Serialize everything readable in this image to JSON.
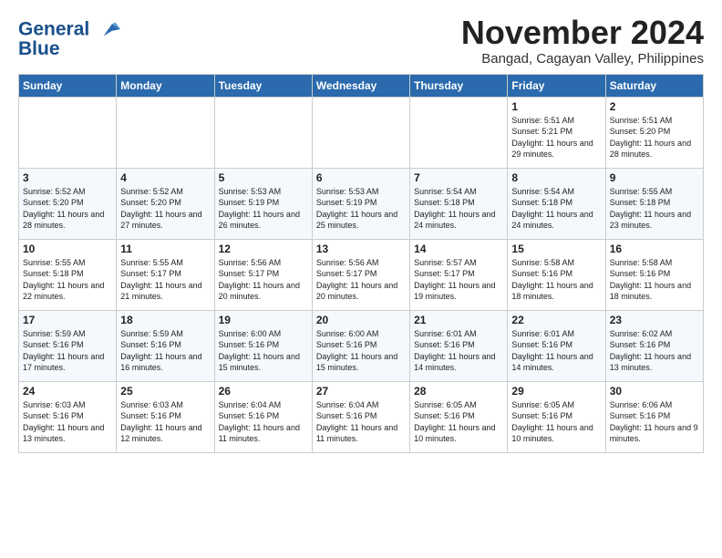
{
  "logo": {
    "line1": "General",
    "line2": "Blue"
  },
  "title": "November 2024",
  "subtitle": "Bangad, Cagayan Valley, Philippines",
  "days_of_week": [
    "Sunday",
    "Monday",
    "Tuesday",
    "Wednesday",
    "Thursday",
    "Friday",
    "Saturday"
  ],
  "weeks": [
    [
      {
        "day": "",
        "info": ""
      },
      {
        "day": "",
        "info": ""
      },
      {
        "day": "",
        "info": ""
      },
      {
        "day": "",
        "info": ""
      },
      {
        "day": "",
        "info": ""
      },
      {
        "day": "1",
        "info": "Sunrise: 5:51 AM\nSunset: 5:21 PM\nDaylight: 11 hours and 29 minutes."
      },
      {
        "day": "2",
        "info": "Sunrise: 5:51 AM\nSunset: 5:20 PM\nDaylight: 11 hours and 28 minutes."
      }
    ],
    [
      {
        "day": "3",
        "info": "Sunrise: 5:52 AM\nSunset: 5:20 PM\nDaylight: 11 hours and 28 minutes."
      },
      {
        "day": "4",
        "info": "Sunrise: 5:52 AM\nSunset: 5:20 PM\nDaylight: 11 hours and 27 minutes."
      },
      {
        "day": "5",
        "info": "Sunrise: 5:53 AM\nSunset: 5:19 PM\nDaylight: 11 hours and 26 minutes."
      },
      {
        "day": "6",
        "info": "Sunrise: 5:53 AM\nSunset: 5:19 PM\nDaylight: 11 hours and 25 minutes."
      },
      {
        "day": "7",
        "info": "Sunrise: 5:54 AM\nSunset: 5:18 PM\nDaylight: 11 hours and 24 minutes."
      },
      {
        "day": "8",
        "info": "Sunrise: 5:54 AM\nSunset: 5:18 PM\nDaylight: 11 hours and 24 minutes."
      },
      {
        "day": "9",
        "info": "Sunrise: 5:55 AM\nSunset: 5:18 PM\nDaylight: 11 hours and 23 minutes."
      }
    ],
    [
      {
        "day": "10",
        "info": "Sunrise: 5:55 AM\nSunset: 5:18 PM\nDaylight: 11 hours and 22 minutes."
      },
      {
        "day": "11",
        "info": "Sunrise: 5:55 AM\nSunset: 5:17 PM\nDaylight: 11 hours and 21 minutes."
      },
      {
        "day": "12",
        "info": "Sunrise: 5:56 AM\nSunset: 5:17 PM\nDaylight: 11 hours and 20 minutes."
      },
      {
        "day": "13",
        "info": "Sunrise: 5:56 AM\nSunset: 5:17 PM\nDaylight: 11 hours and 20 minutes."
      },
      {
        "day": "14",
        "info": "Sunrise: 5:57 AM\nSunset: 5:17 PM\nDaylight: 11 hours and 19 minutes."
      },
      {
        "day": "15",
        "info": "Sunrise: 5:58 AM\nSunset: 5:16 PM\nDaylight: 11 hours and 18 minutes."
      },
      {
        "day": "16",
        "info": "Sunrise: 5:58 AM\nSunset: 5:16 PM\nDaylight: 11 hours and 18 minutes."
      }
    ],
    [
      {
        "day": "17",
        "info": "Sunrise: 5:59 AM\nSunset: 5:16 PM\nDaylight: 11 hours and 17 minutes."
      },
      {
        "day": "18",
        "info": "Sunrise: 5:59 AM\nSunset: 5:16 PM\nDaylight: 11 hours and 16 minutes."
      },
      {
        "day": "19",
        "info": "Sunrise: 6:00 AM\nSunset: 5:16 PM\nDaylight: 11 hours and 15 minutes."
      },
      {
        "day": "20",
        "info": "Sunrise: 6:00 AM\nSunset: 5:16 PM\nDaylight: 11 hours and 15 minutes."
      },
      {
        "day": "21",
        "info": "Sunrise: 6:01 AM\nSunset: 5:16 PM\nDaylight: 11 hours and 14 minutes."
      },
      {
        "day": "22",
        "info": "Sunrise: 6:01 AM\nSunset: 5:16 PM\nDaylight: 11 hours and 14 minutes."
      },
      {
        "day": "23",
        "info": "Sunrise: 6:02 AM\nSunset: 5:16 PM\nDaylight: 11 hours and 13 minutes."
      }
    ],
    [
      {
        "day": "24",
        "info": "Sunrise: 6:03 AM\nSunset: 5:16 PM\nDaylight: 11 hours and 13 minutes."
      },
      {
        "day": "25",
        "info": "Sunrise: 6:03 AM\nSunset: 5:16 PM\nDaylight: 11 hours and 12 minutes."
      },
      {
        "day": "26",
        "info": "Sunrise: 6:04 AM\nSunset: 5:16 PM\nDaylight: 11 hours and 11 minutes."
      },
      {
        "day": "27",
        "info": "Sunrise: 6:04 AM\nSunset: 5:16 PM\nDaylight: 11 hours and 11 minutes."
      },
      {
        "day": "28",
        "info": "Sunrise: 6:05 AM\nSunset: 5:16 PM\nDaylight: 11 hours and 10 minutes."
      },
      {
        "day": "29",
        "info": "Sunrise: 6:05 AM\nSunset: 5:16 PM\nDaylight: 11 hours and 10 minutes."
      },
      {
        "day": "30",
        "info": "Sunrise: 6:06 AM\nSunset: 5:16 PM\nDaylight: 11 hours and 9 minutes."
      }
    ]
  ]
}
